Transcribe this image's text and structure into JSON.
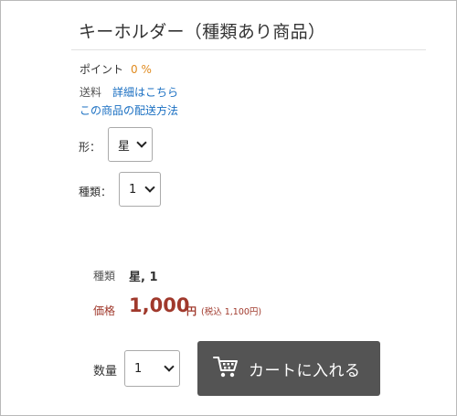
{
  "product": {
    "title": "キーホルダー（種類あり商品）",
    "points_label": "ポイント",
    "points_value": "0 %",
    "shipping_label": "送料",
    "shipping_link": "詳細はこちら",
    "delivery_link": "この商品の配送方法"
  },
  "options": {
    "shape_label": "形：",
    "shape_value": "星",
    "type_label": "種類：",
    "type_value": "1"
  },
  "summary": {
    "type_label": "種類",
    "type_value": "星, 1",
    "price_label": "価格",
    "price_value": "1,000",
    "price_unit": "円",
    "tax_note": "(税込 1,100円)"
  },
  "purchase": {
    "qty_label": "数量",
    "qty_value": "1",
    "cart_label": "カートに入れる"
  }
}
